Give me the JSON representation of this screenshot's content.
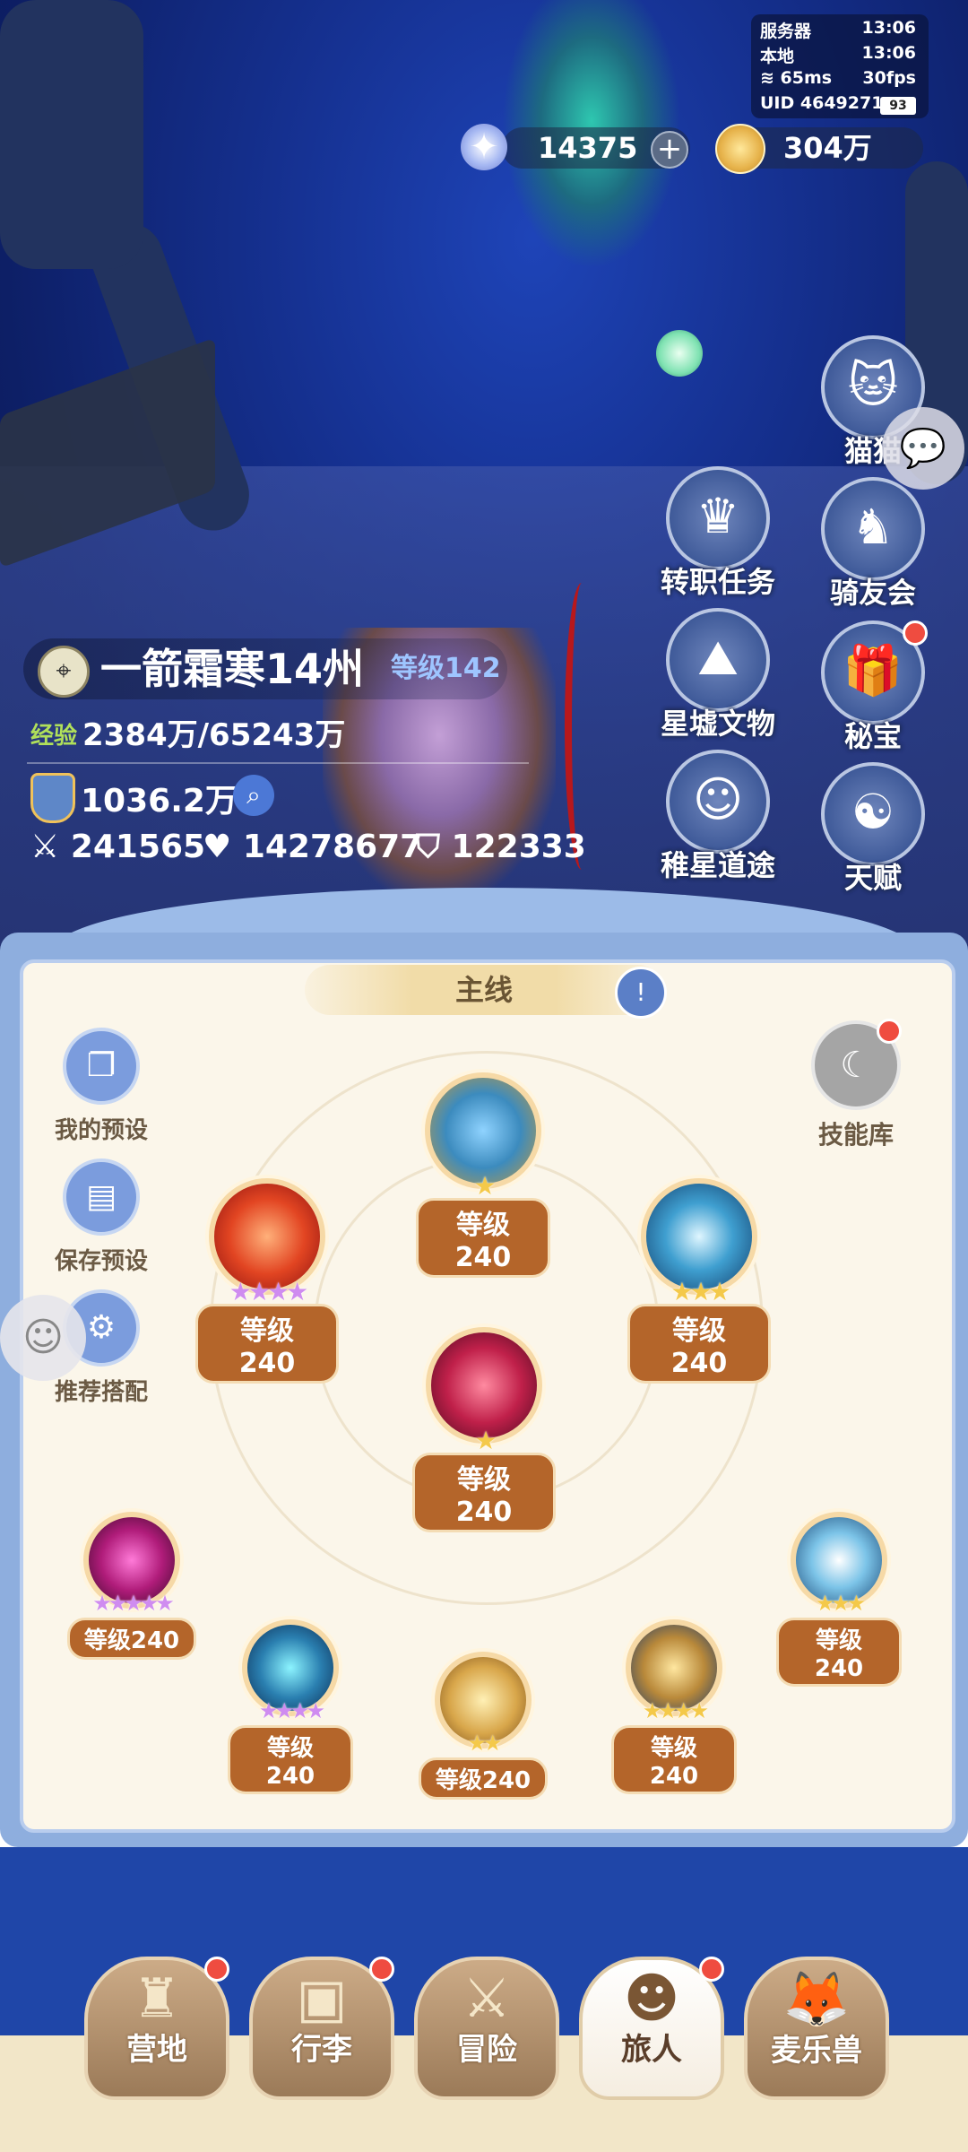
{
  "status": {
    "server_label": "服务器",
    "server_time": "13:06",
    "local_label": "本地",
    "local_time": "13:06",
    "ping": "65ms",
    "fps": "30fps",
    "uid": "UID 4649271",
    "battery": "93"
  },
  "currency": {
    "stars": "14375",
    "coins": "304万"
  },
  "menu": [
    {
      "label": "猫猫",
      "icon": "cat-icon"
    },
    {
      "label": "转职任务",
      "icon": "job-change-icon"
    },
    {
      "label": "骑友会",
      "icon": "horse-icon"
    },
    {
      "label": "星墟文物",
      "icon": "relic-icon"
    },
    {
      "label": "秘宝",
      "icon": "treasure-icon"
    },
    {
      "label": "稚星道途",
      "icon": "path-icon"
    },
    {
      "label": "天赋",
      "icon": "talent-icon"
    }
  ],
  "player": {
    "name": "一箭霜寒14州",
    "level": "等级142",
    "exp_label": "经验",
    "exp": "2384万/65243万",
    "power": "1036.2万",
    "attack": "241565",
    "hp": "14278677",
    "defense": "122333"
  },
  "panel": {
    "tab": "主线",
    "side": [
      "我的预设",
      "保存预设",
      "推荐搭配"
    ],
    "skillbank": "技能库"
  },
  "skills": [
    {
      "level": "等级240",
      "stars": "★",
      "star_color": "gold"
    },
    {
      "level": "等级240",
      "stars": "★★★★",
      "star_color": "purple"
    },
    {
      "level": "等级240",
      "stars": "★★★",
      "star_color": "gold"
    },
    {
      "level": "等级240",
      "stars": "★",
      "star_color": "gold"
    },
    {
      "level": "等级240",
      "stars": "★★★★★",
      "star_color": "purple"
    },
    {
      "level": "等级240",
      "stars": "★★★",
      "star_color": "gold"
    },
    {
      "level": "等级240",
      "stars": "★★★★",
      "star_color": "purple"
    },
    {
      "level": "等级240",
      "stars": "★★",
      "star_color": "gold"
    },
    {
      "level": "等级240",
      "stars": "★★★★",
      "star_color": "gold"
    }
  ],
  "nav": [
    {
      "label": "营地",
      "badge": true
    },
    {
      "label": "行李",
      "badge": true
    },
    {
      "label": "冒险",
      "badge": false
    },
    {
      "label": "旅人",
      "badge": true
    },
    {
      "label": "麦乐兽",
      "badge": false
    }
  ]
}
